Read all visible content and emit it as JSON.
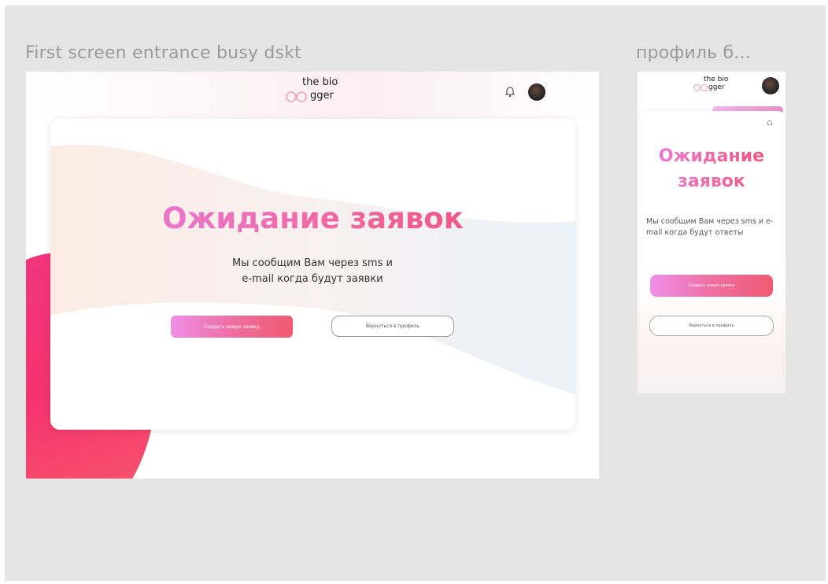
{
  "frames": {
    "desktop_label": "First screen entrance busy dskt",
    "mobile_label": "профиль б..."
  },
  "logo": {
    "line1": "the bio",
    "line2": "gger"
  },
  "desktop": {
    "title": "Ожидание заявок",
    "subtitle_line1": "Мы сообщим Вам через sms и",
    "subtitle_line2": "e-mail когда будут заявки",
    "primary_button": "Создать новую заявку",
    "secondary_button": "Вернуться в профиль"
  },
  "mobile": {
    "title_line1": "Ожидание",
    "title_line2": "заявок",
    "subtitle": "Мы сообщим Вам через sms и e-mail когда будут ответы",
    "primary_button": "Создать новую заявку",
    "secondary_button": "Вернуться в профиль"
  },
  "colors": {
    "canvas": "#e5e5e5",
    "accent_pink": "#ef4b6e",
    "accent_violet": "#e77de6",
    "blob": "#f0357e"
  },
  "icons": [
    "bell-icon",
    "avatar",
    "logo-rings-icon"
  ]
}
